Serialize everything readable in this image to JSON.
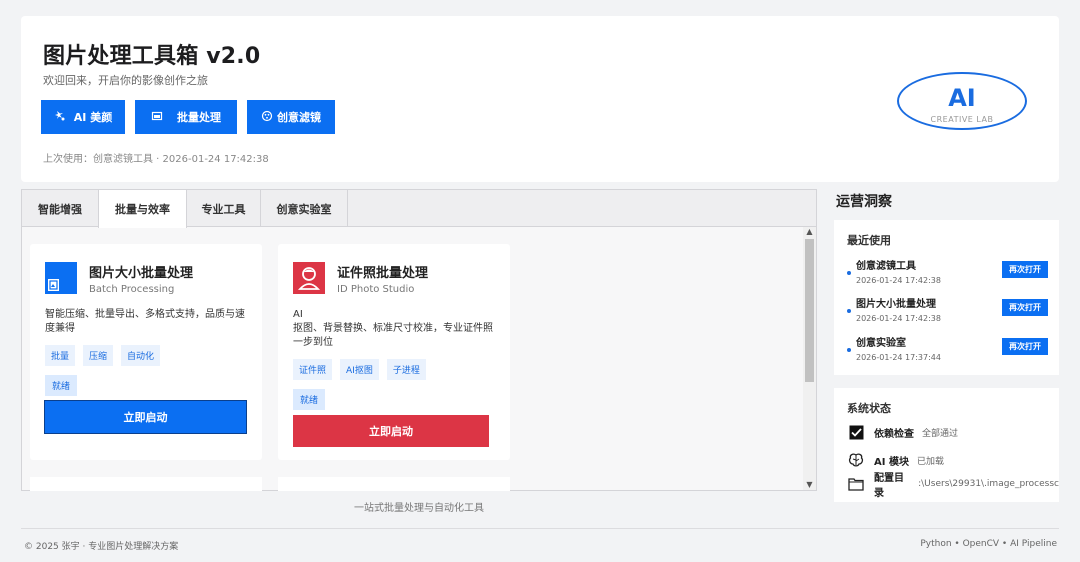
{
  "header": {
    "title": "图片处理工具箱 v2.0",
    "subtitle": "欢迎回来，开启你的影像创作之旅",
    "buttons": [
      {
        "label": "AI 美颜",
        "icon": "sparkle-icon"
      },
      {
        "label": "批量处理",
        "icon": "batch-icon"
      },
      {
        "label": "创意滤镜",
        "icon": "palette-icon"
      }
    ],
    "last_used": "上次使用：创意滤镜工具 · 2026-01-24 17:42:38",
    "logo": {
      "main": "AI",
      "caption": "CREATIVE LAB"
    }
  },
  "tabs": [
    {
      "label": "智能增强",
      "active": false
    },
    {
      "label": "批量与效率",
      "active": true
    },
    {
      "label": "专业工具",
      "active": false
    },
    {
      "label": "创意实验室",
      "active": false
    }
  ],
  "cards": [
    {
      "title": "图片大小批量处理",
      "subtitle": "Batch Processing",
      "description": "智能压缩、批量导出、多格式支持，品质与速度兼得",
      "tags": [
        "批量",
        "压缩",
        "自动化"
      ],
      "status": "就绪",
      "action": "立即启动",
      "icon": "image-icon",
      "color": "#0b6ff2"
    },
    {
      "title": "证件照批量处理",
      "subtitle": "ID Photo Studio",
      "description": "AI\n抠图、背景替换、标准尺寸校准，专业证件照一步到位",
      "tags": [
        "证件照",
        "AI抠图",
        "子进程"
      ],
      "status": "就绪",
      "action": "立即启动",
      "icon": "portrait-icon",
      "color": "#dc3545"
    }
  ],
  "tab_footer": "一站式批量处理与自动化工具",
  "sidebar": {
    "title": "运营洞察",
    "recent": {
      "heading": "最近使用",
      "items": [
        {
          "name": "创意滤镜工具",
          "time": "2026-01-24 17:42:38",
          "action": "再次打开"
        },
        {
          "name": "图片大小批量处理",
          "time": "2026-01-24 17:42:38",
          "action": "再次打开"
        },
        {
          "name": "创意实验室",
          "time": "2026-01-24 17:37:44",
          "action": "再次打开"
        }
      ]
    },
    "status": {
      "heading": "系统状态",
      "items": [
        {
          "label": "依赖检查",
          "value": "全部通过",
          "icon": "checkbox-icon"
        },
        {
          "label": "AI 模块",
          "value": "已加载",
          "icon": "brain-icon"
        },
        {
          "label": "配置目录",
          "value": ":\\Users\\29931\\.image_processc",
          "icon": "folder-icon"
        }
      ]
    }
  },
  "footer": {
    "left": "© 2025 张宇 · 专业图片处理解决方案",
    "right": "Python • OpenCV • AI Pipeline"
  },
  "colors": {
    "primary": "#0b6ff2",
    "danger": "#dc3545",
    "tag_bg": "#eaf2fd"
  }
}
